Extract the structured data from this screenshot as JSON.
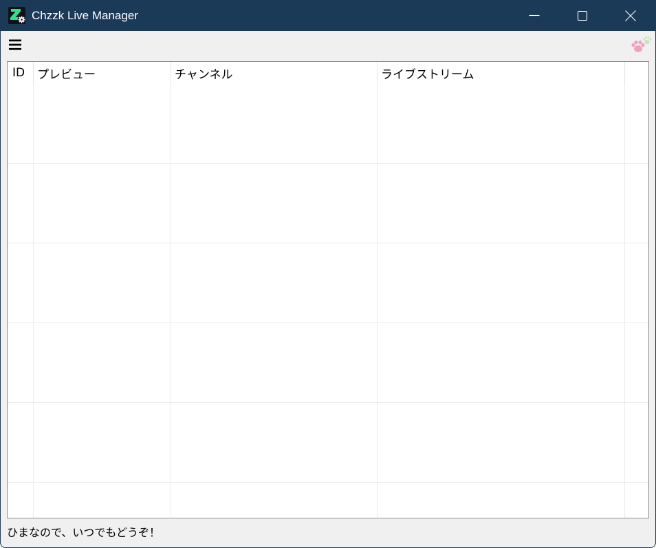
{
  "window": {
    "title": "Chzzk Live Manager",
    "icon": "chzzk-app-icon",
    "controls": {
      "minimize": "minimize-icon",
      "maximize": "maximize-icon",
      "close": "close-icon"
    }
  },
  "toolbar": {
    "menu_icon": "hamburger-menu-icon",
    "mascot_icon": "paw-icon"
  },
  "grid": {
    "columns": [
      "ID",
      "プレビュー",
      "チャンネル",
      "ライブストリーム"
    ]
  },
  "status_bar": {
    "text": "ひまなので、いつでもどうぞ！"
  },
  "colors": {
    "title_bar": "#1b3a58",
    "title_text": "#ffffff",
    "window_bg": "#f0f0f0",
    "grid_bg": "#ffffff",
    "grid_border": "#8c8c8c",
    "grid_lines": "#ebebeb",
    "icon_green": "#2fe08f",
    "paw_pink": "#f2a0be",
    "paw_green": "#c6e5b9"
  }
}
